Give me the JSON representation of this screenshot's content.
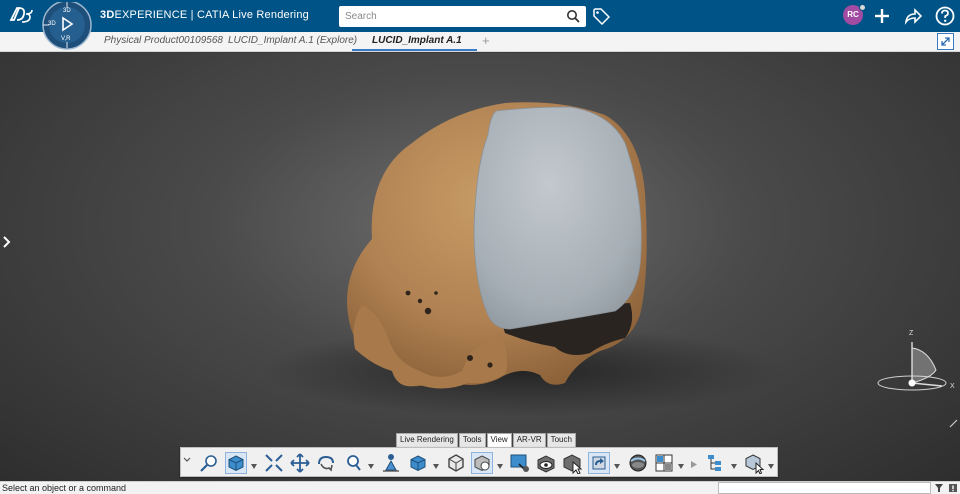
{
  "header": {
    "brand_bold": "3D",
    "brand_rest": "EXPERIENCE | CATIA Live Rendering",
    "search": {
      "placeholder": "Search"
    },
    "compass_labels": {
      "top": "3D",
      "left": "3D",
      "bottom": "V,R"
    },
    "avatar_initials": "RC"
  },
  "tabs": [
    {
      "label": "Physical Product00109568",
      "active": false
    },
    {
      "label": "LUCID_Implant A.1 (Explore)",
      "active": false
    },
    {
      "label": "LUCID_Implant A.1",
      "active": true
    }
  ],
  "section_tabs": [
    {
      "label": "Live Rendering",
      "active": false
    },
    {
      "label": "Tools",
      "active": false
    },
    {
      "label": "View",
      "active": true
    },
    {
      "label": "AR-VR",
      "active": false
    },
    {
      "label": "Touch",
      "active": false
    }
  ],
  "compass_axes": {
    "z": "Z",
    "x": "X"
  },
  "status": {
    "message": "Select an object or a command"
  },
  "colors": {
    "topbar": "#005386",
    "skull": "#b58a55",
    "implant": "#b7bfc6",
    "accent": "#3a7bc8"
  }
}
